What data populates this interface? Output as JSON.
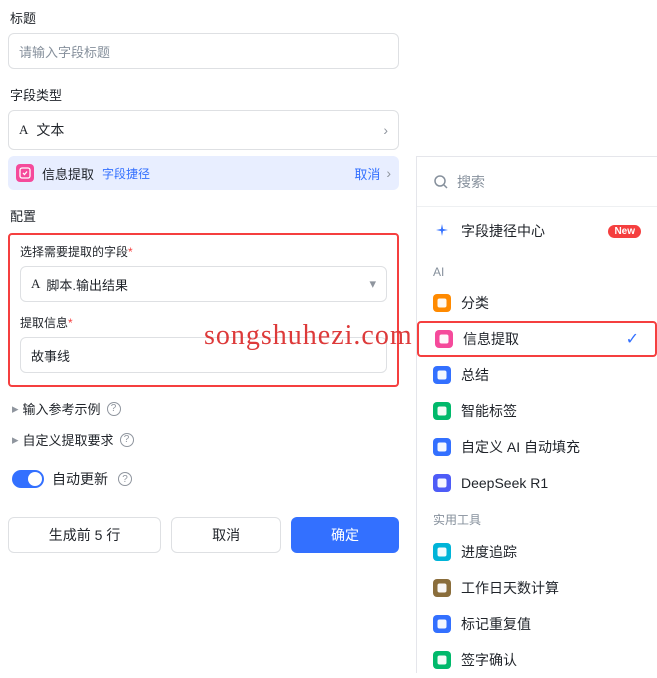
{
  "left": {
    "title_label": "标题",
    "title_placeholder": "请输入字段标题",
    "type_label": "字段类型",
    "type_value": "文本",
    "shortcut": {
      "name": "信息提取",
      "path_label": "字段捷径",
      "cancel": "取消"
    },
    "config_label": "配置",
    "field_select_label": "选择需要提取的字段",
    "field_select_value": "脚本.输出结果",
    "extract_label": "提取信息",
    "extract_value": "故事线",
    "expander_examples": "输入参考示例",
    "expander_custom": "自定义提取要求",
    "auto_update": "自动更新",
    "btn_generate": "生成前 5 行",
    "btn_cancel": "取消",
    "btn_confirm": "确定"
  },
  "right": {
    "search_placeholder": "搜索",
    "shortcut_center": "字段捷径中心",
    "new_badge": "New",
    "group_ai": "AI",
    "group_tools": "实用工具",
    "ai_items": [
      {
        "id": "classify",
        "label": "分类",
        "color": "#ff8a00"
      },
      {
        "id": "extract",
        "label": "信息提取",
        "color": "#f54a9b",
        "selected": true
      },
      {
        "id": "summary",
        "label": "总结",
        "color": "#3370ff"
      },
      {
        "id": "tags",
        "label": "智能标签",
        "color": "#00b96b"
      },
      {
        "id": "autofill",
        "label": "自定义 AI 自动填充",
        "color": "#3370ff"
      },
      {
        "id": "deepseek",
        "label": "DeepSeek R1",
        "color": "#4e5cf7"
      }
    ],
    "tool_items": [
      {
        "id": "progress",
        "label": "进度追踪",
        "color": "#00b4d8"
      },
      {
        "id": "workdays",
        "label": "工作日天数计算",
        "color": "#8a6d3b"
      },
      {
        "id": "dedupe",
        "label": "标记重复值",
        "color": "#3370ff"
      },
      {
        "id": "sign",
        "label": "签字确认",
        "color": "#00b96b"
      }
    ]
  },
  "watermark": "songshuhezi.com"
}
